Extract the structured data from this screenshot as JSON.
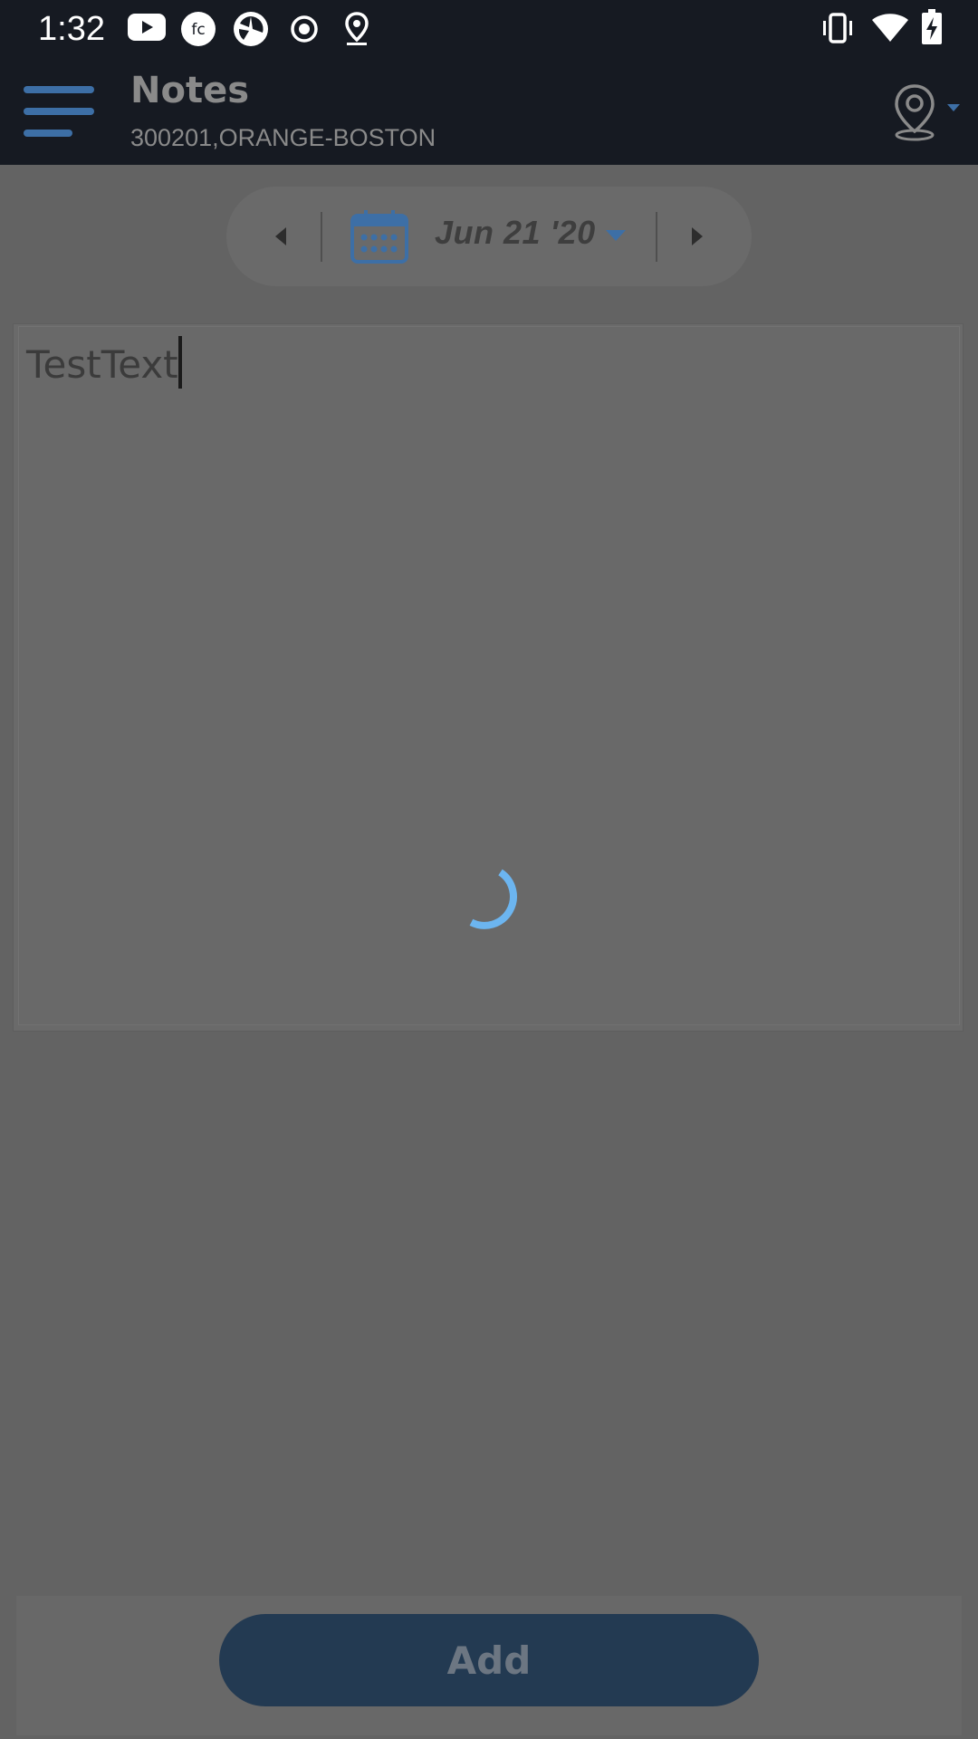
{
  "status_bar": {
    "time": "1:32",
    "left_icons": [
      "youtube-icon",
      "fc-icon",
      "shutter-app-icon",
      "record-icon",
      "location-icon"
    ],
    "right_icons": [
      "vibrate-icon",
      "wifi-icon",
      "battery-charging-icon"
    ]
  },
  "app_bar": {
    "title": "Notes",
    "subtitle": "300201,ORANGE-BOSTON",
    "menu_icon": "hamburger-menu-icon",
    "location_icon": "location-pin-icon"
  },
  "date_nav": {
    "date": "Jun 21 '20",
    "prev_icon": "chevron-left-icon",
    "next_icon": "chevron-right-icon",
    "calendar_icon": "calendar-icon"
  },
  "note": {
    "value": "TestText"
  },
  "loading": {
    "spinner_icon": "loading-spinner-icon"
  },
  "actions": {
    "add_label": "Add"
  },
  "colors": {
    "accent_blue": "#4a86c5",
    "spinner": "#6cb5f0",
    "add_button": "#233a52",
    "bar_bg": "#161a22",
    "overlay_bg": "#636363"
  }
}
